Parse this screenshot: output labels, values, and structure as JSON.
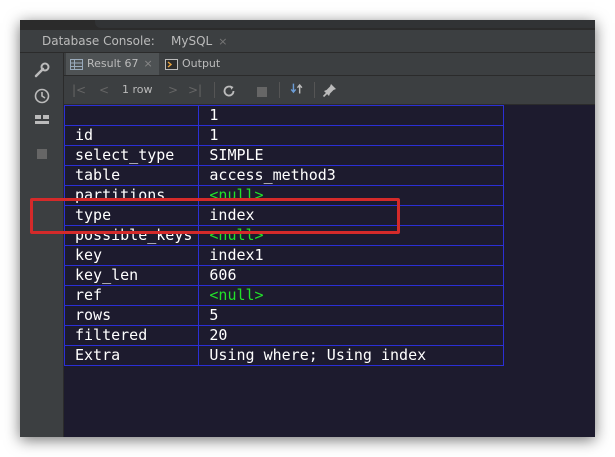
{
  "console": {
    "label": "Database Console:",
    "tab_label": "MySQL",
    "tab_close": "×"
  },
  "results_tabs": {
    "result_label": "Result 67",
    "result_close": "×",
    "output_label": "Output"
  },
  "toolbar": {
    "first": "|<",
    "prev": "<",
    "row_count": "1 row",
    "next": ">",
    "last": ">|"
  },
  "grid": {
    "header": [
      "",
      "1"
    ],
    "rows": [
      {
        "key": "id",
        "value": "1"
      },
      {
        "key": "select_type",
        "value": "SIMPLE"
      },
      {
        "key": "table",
        "value": "access_method3"
      },
      {
        "key": "partitions",
        "value": "<null>"
      },
      {
        "key": "type",
        "value": "index"
      },
      {
        "key": "possible_keys",
        "value": "<null>"
      },
      {
        "key": "key",
        "value": "index1"
      },
      {
        "key": "key_len",
        "value": "606"
      },
      {
        "key": "ref",
        "value": "<null>"
      },
      {
        "key": "rows",
        "value": "5"
      },
      {
        "key": "filtered",
        "value": "20"
      },
      {
        "key": "Extra",
        "value": "Using where; Using index"
      }
    ]
  },
  "colors": {
    "null_value": "#22e02a",
    "grid_border": "#2b2fd6",
    "grid_background": "#1d1b2e",
    "highlight": "#d42a2a"
  },
  "icons": [
    "wrench-icon",
    "clock-icon",
    "layout-icon",
    "stop-icon",
    "table-icon",
    "output-icon",
    "refresh-icon",
    "pin-icon"
  ]
}
